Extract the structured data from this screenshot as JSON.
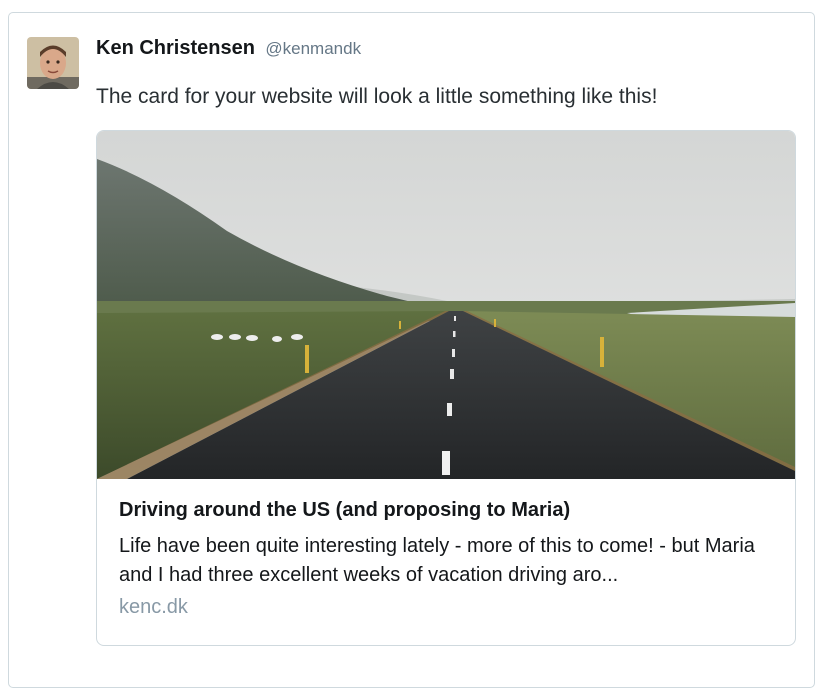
{
  "tweet": {
    "author": {
      "name": "Ken Christensen",
      "handle": "@kenmandk",
      "avatar_icon": "user-avatar"
    },
    "text": "The card for your website will look a little something like this!",
    "card": {
      "image_icon": "road-landscape-photo",
      "title": "Driving around the US (and proposing to Maria)",
      "description": "Life have been quite interesting lately - more of this to come! - but Maria and I had three excellent weeks of vacation driving aro...",
      "domain": "kenc.dk"
    }
  },
  "colors": {
    "border": "#cfd9de",
    "text_primary": "#14171a",
    "text_secondary": "#657786",
    "domain": "#8899a6"
  }
}
